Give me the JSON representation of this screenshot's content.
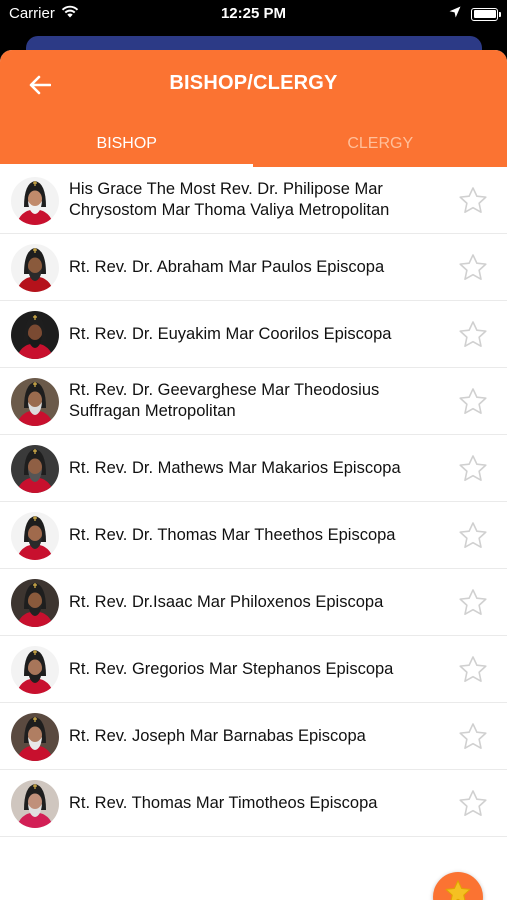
{
  "status_bar": {
    "carrier": "Carrier",
    "time": "12:25 PM"
  },
  "header": {
    "title": "BISHOP/CLERGY"
  },
  "tabs": [
    {
      "label": "BISHOP",
      "active": true
    },
    {
      "label": "CLERGY",
      "active": false
    }
  ],
  "colors": {
    "accent": "#fb7332",
    "behind_card": "#2c3a86",
    "star_outline": "#d0d0d0",
    "fab_star": "#f5c022"
  },
  "list": {
    "items": [
      {
        "name": "His Grace The Most Rev. Dr. Philipose Mar Chrysostom Mar Thoma Valiya Metropolitan",
        "vestment": "#c8102e",
        "skin": "#c08a6b",
        "hair": "#f0f0f0",
        "bg": "#f3f3f3"
      },
      {
        "name": "Rt. Rev. Dr. Abraham Mar Paulos Episcopa",
        "vestment": "#b5121b",
        "skin": "#8a5a3c",
        "hair": "#2a2a2a",
        "bg": "#f3f3f3"
      },
      {
        "name": "Rt. Rev. Dr. Euyakim Mar Coorilos Episcopa",
        "vestment": "#c8102e",
        "skin": "#7a4a32",
        "hair": "#1a1a1a",
        "bg": "#1d1d1d"
      },
      {
        "name": "Rt. Rev. Dr. Geevarghese Mar Theodosius Suffragan Metropolitan",
        "vestment": "#c8102e",
        "skin": "#9a6b4e",
        "hair": "#dcdcdc",
        "bg": "#6b5a4a"
      },
      {
        "name": "Rt. Rev. Dr. Mathews Mar Makarios Episcopa",
        "vestment": "#c8102e",
        "skin": "#8f5f44",
        "hair": "#555555",
        "bg": "#3a3a3a"
      },
      {
        "name": "Rt. Rev. Dr. Thomas Mar Theethos Episcopa",
        "vestment": "#c8102e",
        "skin": "#a06a4c",
        "hair": "#2a2a2a",
        "bg": "#f3f3f3"
      },
      {
        "name": "Rt. Rev. Dr.Isaac Mar Philoxenos Episcopa",
        "vestment": "#c8102e",
        "skin": "#8a5a3c",
        "hair": "#222222",
        "bg": "#3d3530"
      },
      {
        "name": "Rt. Rev. Gregorios Mar Stephanos Episcopa",
        "vestment": "#c8102e",
        "skin": "#a8765a",
        "hair": "#1f1f1f",
        "bg": "#f3f3f3"
      },
      {
        "name": "Rt. Rev. Joseph Mar Barnabas Episcopa",
        "vestment": "#c8102e",
        "skin": "#b07e62",
        "hair": "#e8e8e8",
        "bg": "#5a4a40"
      },
      {
        "name": "Rt. Rev. Thomas Mar Timotheos Episcopa",
        "vestment": "#d21f55",
        "skin": "#c0907a",
        "hair": "#e0e0e0",
        "bg": "#cfc6bf"
      }
    ]
  }
}
